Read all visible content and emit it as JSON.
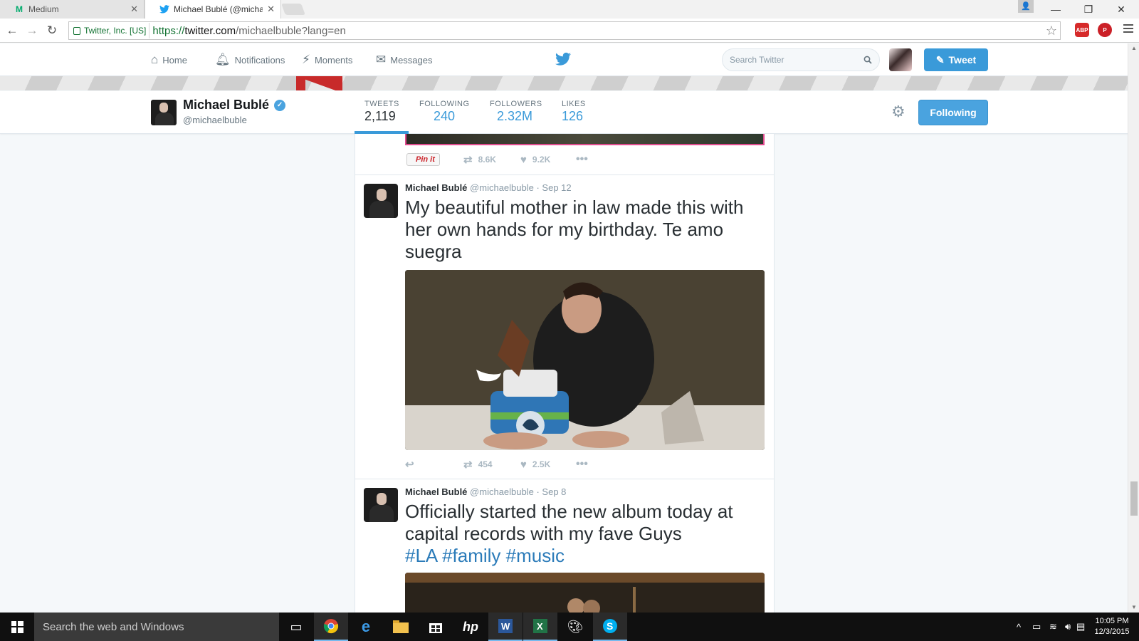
{
  "browser": {
    "tabs": [
      {
        "label": "Medium",
        "icon": "medium-icon"
      },
      {
        "label": "Michael Bublé (@michaelb",
        "icon": "twitter-icon"
      }
    ],
    "ev_label": "Twitter, Inc. [US]",
    "url_scheme": "https://",
    "url_host": "twitter.com",
    "url_path": "/michaelbuble?lang=en",
    "extensions": [
      "adblock-icon",
      "pinterest-icon"
    ]
  },
  "twitter_nav": {
    "items": [
      "Home",
      "Notifications",
      "Moments",
      "Messages"
    ],
    "search_placeholder": "Search Twitter",
    "tweet_button": "Tweet"
  },
  "profile": {
    "name": "Michael Bublé",
    "handle": "@michaelbuble",
    "stats": [
      {
        "label": "TWEETS",
        "value": "2,119"
      },
      {
        "label": "FOLLOWING",
        "value": "240"
      },
      {
        "label": "FOLLOWERS",
        "value": "2.32M"
      },
      {
        "label": "LIKES",
        "value": "126"
      }
    ],
    "follow_button": "Following",
    "accent": "#3a9ad9"
  },
  "prev_tweet_actions": {
    "pin_label": "Pin it",
    "retweets": "8.6K",
    "likes": "9.2K"
  },
  "tweets": [
    {
      "name": "Michael Bublé",
      "handle": "@michaelbuble",
      "date": "· Sep 12",
      "text": "My beautiful mother in law made this with her own hands for my birthday. Te amo suegra",
      "retweets": "454",
      "likes": "2.5K"
    },
    {
      "name": "Michael Bublé",
      "handle": "@michaelbuble",
      "date": "· Sep 8",
      "text": "Officially started the new album today at capital records with my fave Guys",
      "hashtags": [
        "#LA",
        "#family",
        "#music"
      ]
    }
  ],
  "taskbar": {
    "search_placeholder": "Search the web and Windows",
    "apps": [
      "task-view-icon",
      "chrome-icon",
      "edge-icon",
      "file-explorer-icon",
      "store-icon",
      "hp-icon",
      "word-icon",
      "excel-icon",
      "paint-icon",
      "skype-icon"
    ],
    "time": "10:05 PM",
    "date": "12/3/2015"
  }
}
